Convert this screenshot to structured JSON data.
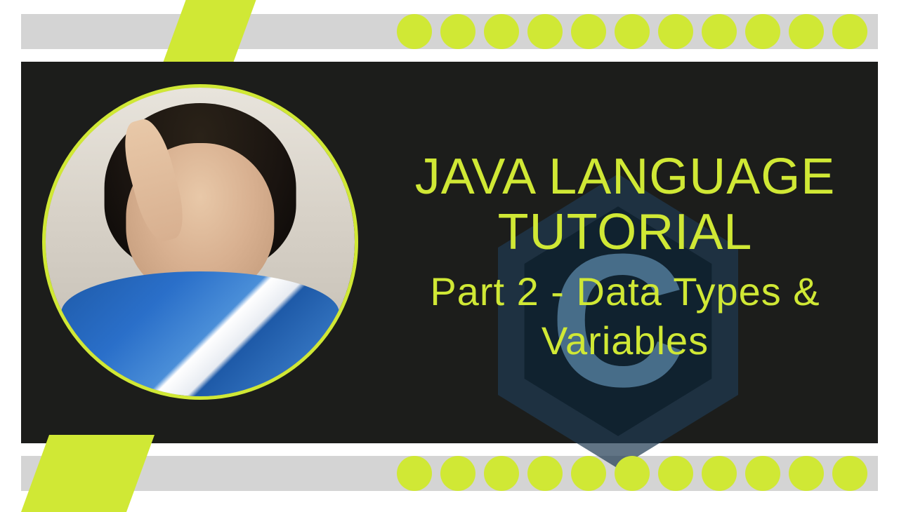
{
  "colors": {
    "accent": "#d0e835",
    "panel": "#1c1d1b",
    "band": "#d4d4d4",
    "hex_outer": "#1f3a52",
    "hex_inner": "#0c2538",
    "hex_letter": "#5a90b8"
  },
  "decorative": {
    "dots_top_count": 11,
    "dots_bottom_count": 11,
    "hex_letter": "C"
  },
  "title": {
    "main": "JAVA LANGUAGE TUTORIAL",
    "sub": "Part 2 - Data Types & Variables"
  }
}
